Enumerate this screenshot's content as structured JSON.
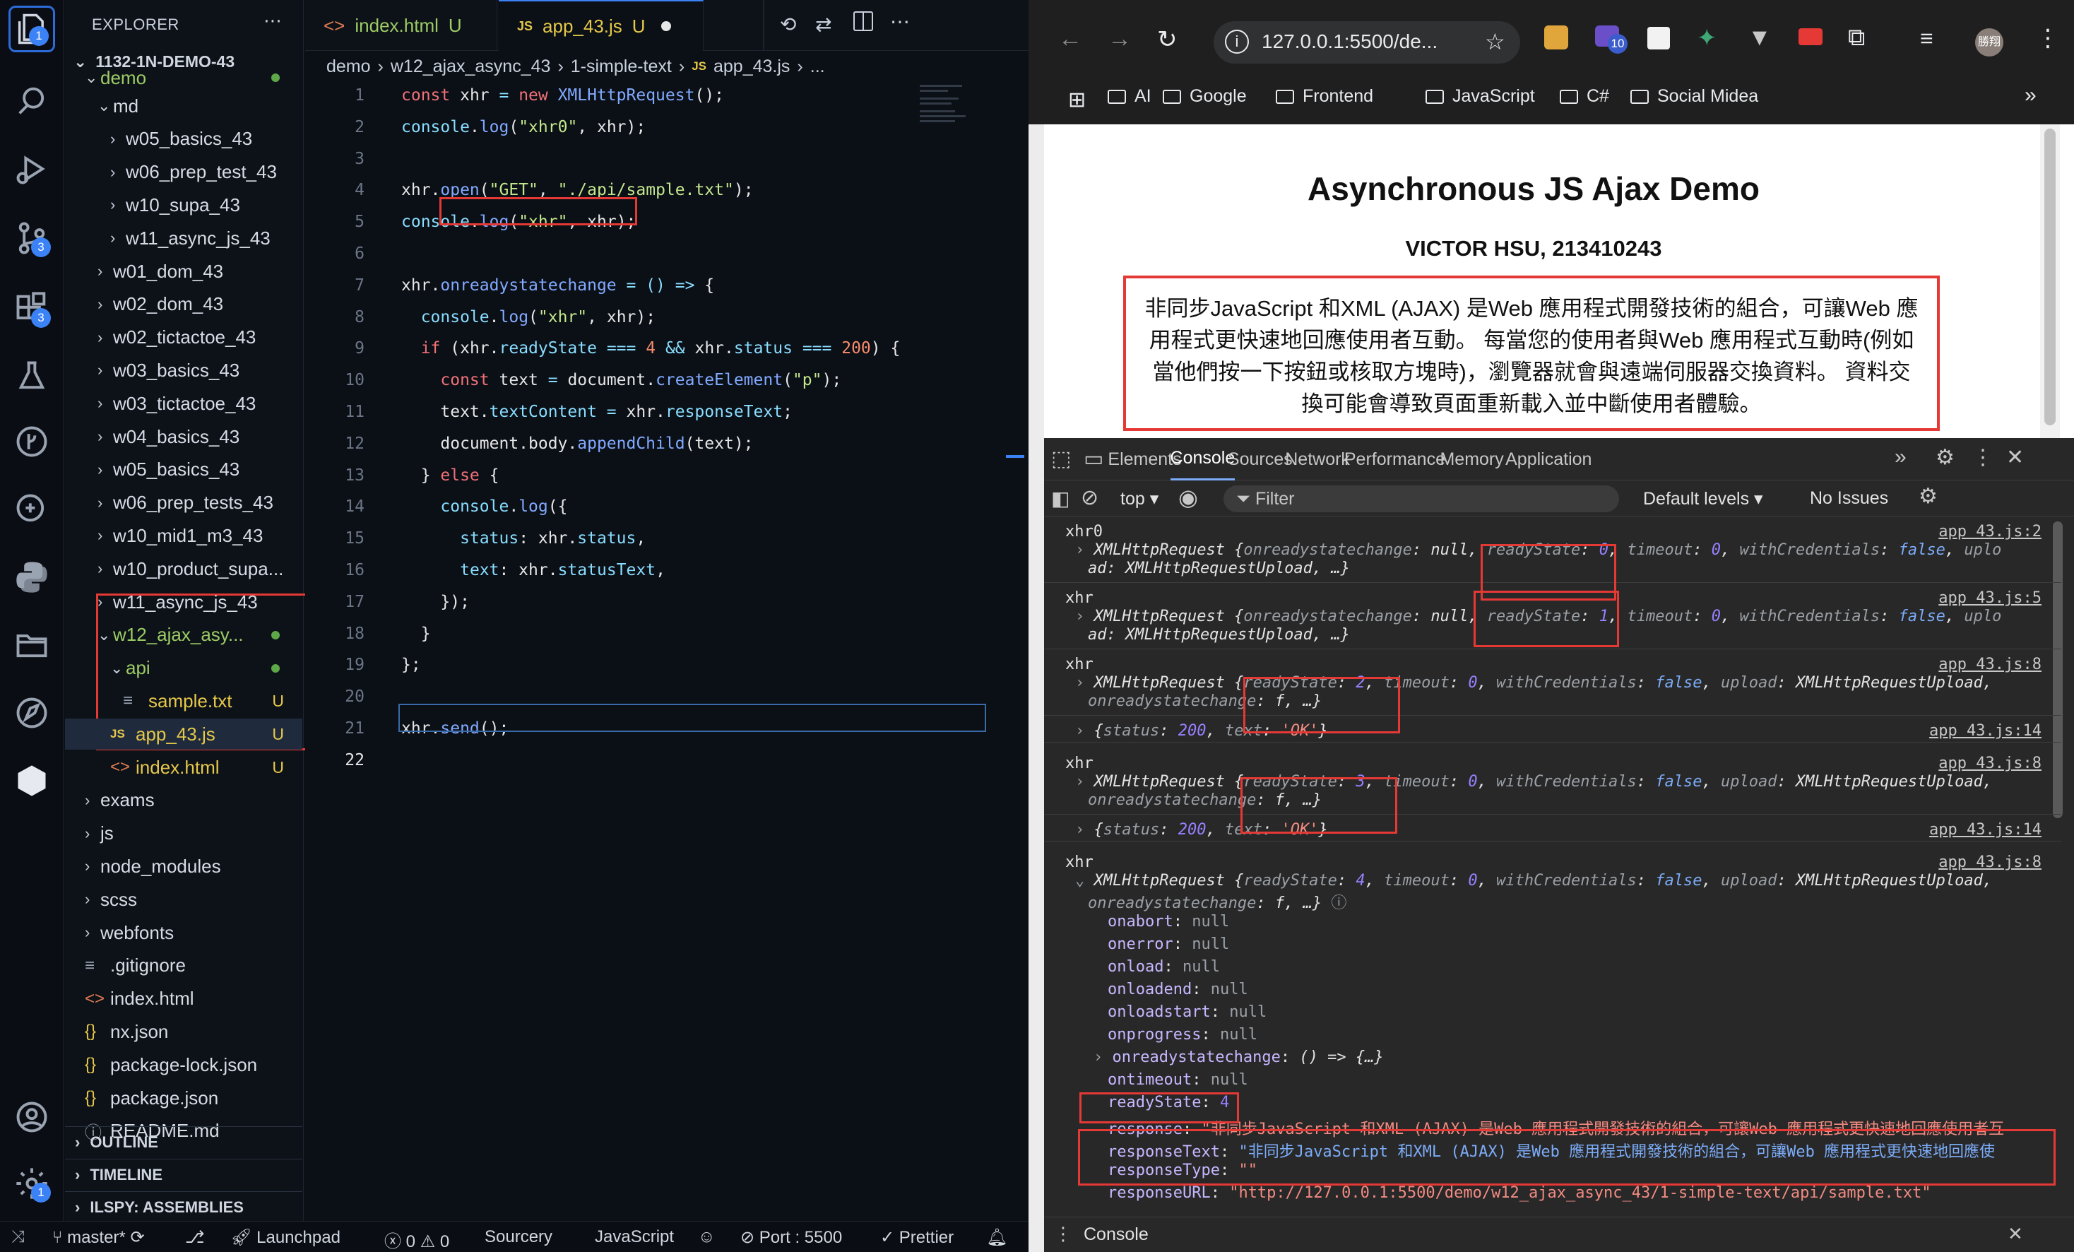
{
  "vscode": {
    "activity_badges": {
      "explorer": "1",
      "scm": "3",
      "extensions": "3",
      "settings": "1"
    },
    "explorer_title": "EXPLORER",
    "project": "1132-1N-DEMO-43",
    "tree": [
      {
        "label": "demo",
        "indent": 1,
        "chev": "⌄",
        "dot": true,
        "cls": "green"
      },
      {
        "label": "md",
        "indent": 2,
        "chev": "⌄"
      },
      {
        "label": "w05_basics_43",
        "indent": 3,
        "chev": "›"
      },
      {
        "label": "w06_prep_test_43",
        "indent": 3,
        "chev": "›"
      },
      {
        "label": "w10_supa_43",
        "indent": 3,
        "chev": "›"
      },
      {
        "label": "w11_async_js_43",
        "indent": 3,
        "chev": "›"
      },
      {
        "label": "w01_dom_43",
        "indent": 2,
        "chev": "›"
      },
      {
        "label": "w02_dom_43",
        "indent": 2,
        "chev": "›"
      },
      {
        "label": "w02_tictactoe_43",
        "indent": 2,
        "chev": "›"
      },
      {
        "label": "w03_basics_43",
        "indent": 2,
        "chev": "›"
      },
      {
        "label": "w03_tictactoe_43",
        "indent": 2,
        "chev": "›"
      },
      {
        "label": "w04_basics_43",
        "indent": 2,
        "chev": "›"
      },
      {
        "label": "w05_basics_43",
        "indent": 2,
        "chev": "›"
      },
      {
        "label": "w06_prep_tests_43",
        "indent": 2,
        "chev": "›"
      },
      {
        "label": "w10_mid1_m3_43",
        "indent": 2,
        "chev": "›"
      },
      {
        "label": "w10_product_supa...",
        "indent": 2,
        "chev": "›"
      },
      {
        "label": "w11_async_js_43",
        "indent": 2,
        "chev": "›"
      },
      {
        "label": "w12_ajax_asy...",
        "indent": 2,
        "chev": "⌄",
        "dot": true,
        "cls": "green"
      },
      {
        "label": "api",
        "indent": 3,
        "chev": "⌄",
        "dot": true,
        "cls": "green"
      },
      {
        "label": "sample.txt",
        "indent": 4,
        "icon": "≡",
        "u": "U",
        "cls": "yellow"
      },
      {
        "label": "app_43.js",
        "indent": 3,
        "icon": "JS",
        "u": "U",
        "cls": "yellow",
        "sel": true
      },
      {
        "label": "index.html",
        "indent": 3,
        "icon": "<>",
        "u": "U",
        "cls": "yellow"
      },
      {
        "label": "exams",
        "indent": 1,
        "chev": "›"
      },
      {
        "label": "js",
        "indent": 1,
        "chev": "›"
      },
      {
        "label": "node_modules",
        "indent": 1,
        "chev": "›"
      },
      {
        "label": "scss",
        "indent": 1,
        "chev": "›"
      },
      {
        "label": "webfonts",
        "indent": 1,
        "chev": "›"
      },
      {
        "label": ".gitignore",
        "indent": 1,
        "icon": "≡"
      },
      {
        "label": "index.html",
        "indent": 1,
        "icon": "<>"
      },
      {
        "label": "nx.json",
        "indent": 1,
        "icon": "{}"
      },
      {
        "label": "package-lock.json",
        "indent": 1,
        "icon": "{}"
      },
      {
        "label": "package.json",
        "indent": 1,
        "icon": "{}"
      },
      {
        "label": "README.md",
        "indent": 1,
        "icon": "ⓘ"
      }
    ],
    "panels": [
      "OUTLINE",
      "TIMELINE",
      "ILSPY: ASSEMBLIES"
    ],
    "tabs": [
      {
        "label": "index.html",
        "u": "U"
      },
      {
        "label": "app_43.js",
        "u": "U"
      }
    ],
    "breadcrumb": [
      "demo",
      "w12_ajax_async_43",
      "1-simple-text",
      "app_43.js",
      "..."
    ],
    "status": {
      "branch": "master*",
      "launchpad": "Launchpad",
      "problems": "0",
      "warnings": "0",
      "sourcery": "Sourcery",
      "language": "JavaScript",
      "port": "Port : 5500",
      "prettier": "Prettier"
    }
  },
  "browser": {
    "url": "127.0.0.1:5500/de...",
    "ext_badge": "10",
    "avatar": "勝翔",
    "bookmarks": [
      "AI",
      "Google",
      "Frontend",
      "JavaScript",
      "C#",
      "Social Midea"
    ],
    "page_title": "Asynchronous JS Ajax Demo",
    "page_subtitle": "VICTOR HSU, 213410243",
    "page_text": "非同步JavaScript 和XML (AJAX) 是Web 應用程式開發技術的組合，可讓Web 應用程式更快速地回應使用者互動。 每當您的使用者與Web 應用程式互動時(例如當他們按一下按鈕或核取方塊時)，瀏覽器就會與遠端伺服器交換資料。 資料交換可能會導致頁面重新載入並中斷使用者體驗。",
    "devtools_tabs": [
      "Elements",
      "Console",
      "Sources",
      "Network",
      "Performance",
      "Memory",
      "Application"
    ],
    "console_context": "top",
    "filter_placeholder": "Filter",
    "levels": "Default levels",
    "issues": "No Issues",
    "drawer_tab": "Console"
  }
}
